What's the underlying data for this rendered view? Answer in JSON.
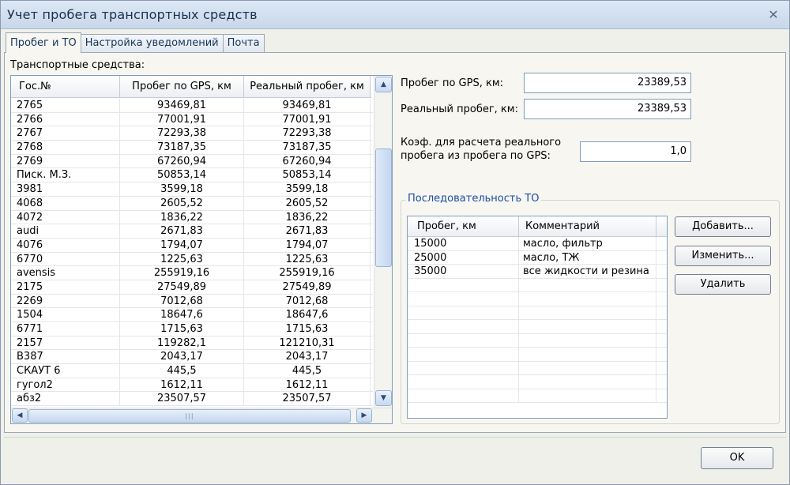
{
  "window": {
    "title": "Учет пробега транспортных средств",
    "close_glyph": "✕"
  },
  "tabs": [
    {
      "label": "Пробег и ТО",
      "active": true
    },
    {
      "label": "Настройка уведомлений",
      "active": false
    },
    {
      "label": "Почта",
      "active": false
    }
  ],
  "vehicles": {
    "label": "Транспортные средства:",
    "columns": [
      "Гос.№",
      "Пробег по GPS, км",
      "Реальный пробег, км"
    ],
    "rows": [
      [
        "2765",
        "93469,81",
        "93469,81"
      ],
      [
        "2766",
        "77001,91",
        "77001,91"
      ],
      [
        "2767",
        "72293,38",
        "72293,38"
      ],
      [
        "2768",
        "73187,35",
        "73187,35"
      ],
      [
        "2769",
        "67260,94",
        "67260,94"
      ],
      [
        "Писк. М.З.",
        "50853,14",
        "50853,14"
      ],
      [
        "3981",
        "3599,18",
        "3599,18"
      ],
      [
        "4068",
        "2605,52",
        "2605,52"
      ],
      [
        "4072",
        "1836,22",
        "1836,22"
      ],
      [
        "audi",
        "2671,83",
        "2671,83"
      ],
      [
        "4076",
        "1794,07",
        "1794,07"
      ],
      [
        "6770",
        "1225,63",
        "1225,63"
      ],
      [
        "avensis",
        "255919,16",
        "255919,16"
      ],
      [
        "2175",
        "27549,89",
        "27549,89"
      ],
      [
        "2269",
        "7012,68",
        "7012,68"
      ],
      [
        "1504",
        "18647,6",
        "18647,6"
      ],
      [
        "6771",
        "1715,63",
        "1715,63"
      ],
      [
        "2157",
        "119282,1",
        "121210,31"
      ],
      [
        "В387",
        "2043,17",
        "2043,17"
      ],
      [
        "СКАУТ 6",
        "445,5",
        "445,5"
      ],
      [
        "гугол2",
        "1612,11",
        "1612,11"
      ],
      [
        "абз2",
        "23507,57",
        "23507,57"
      ]
    ],
    "scroll_up_glyph": "▲",
    "scroll_down_glyph": "▼",
    "scroll_left_glyph": "◀",
    "scroll_right_glyph": "▶",
    "thumb_grip": "|||"
  },
  "fields": {
    "gps_label": "Пробег по GPS, км:",
    "gps_value": "23389,53",
    "real_label": "Реальный пробег, км:",
    "real_value": "23389,53",
    "coef_label_line1": "Коэф. для расчета реального",
    "coef_label_line2": "пробега из пробега по GPS:",
    "coef_value": "1,0"
  },
  "maintenance": {
    "title": "Последовательность ТО",
    "columns": [
      "Пробег, км",
      "Комментарий"
    ],
    "rows": [
      [
        "15000",
        "масло, фильтр"
      ],
      [
        "25000",
        "масло, ТЖ"
      ],
      [
        "35000",
        "все жидкости и резина"
      ]
    ],
    "empty_rows": 9
  },
  "buttons": {
    "add": "Добавить...",
    "edit": "Изменить...",
    "delete": "Удалить",
    "ok": "OK"
  }
}
